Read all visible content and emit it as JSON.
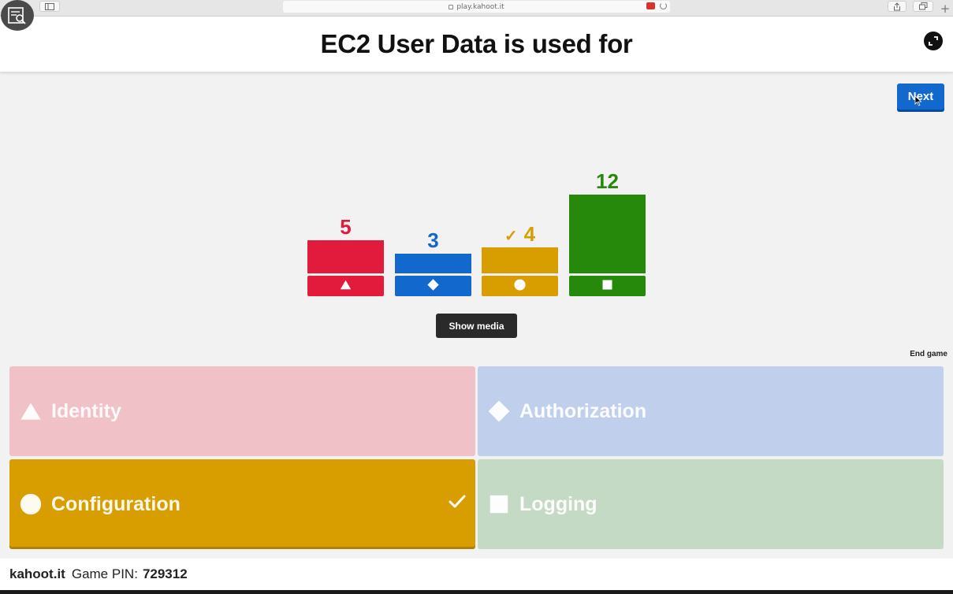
{
  "browser": {
    "url": "play.kahoot.it"
  },
  "question": {
    "title": "EC2 User Data is used for"
  },
  "controls": {
    "next_label": "Next",
    "show_media_label": "Show media",
    "end_game_label": "End game"
  },
  "chart_data": {
    "type": "bar",
    "categories": [
      "Identity",
      "Authorization",
      "Configuration",
      "Logging"
    ],
    "values": [
      5,
      3,
      4,
      12
    ],
    "correct": [
      false,
      false,
      true,
      false
    ],
    "shapes": [
      "triangle",
      "diamond",
      "circle",
      "square"
    ],
    "colors": [
      "#e21b3c",
      "#1368ce",
      "#d89e00",
      "#26890c"
    ]
  },
  "answers": [
    {
      "label": "Identity",
      "shape": "triangle",
      "color": "#f1c1c8",
      "correct": false
    },
    {
      "label": "Authorization",
      "shape": "diamond",
      "color": "#c0d0ec",
      "correct": false
    },
    {
      "label": "Configuration",
      "shape": "circle",
      "color": "#d89e00",
      "correct": true
    },
    {
      "label": "Logging",
      "shape": "square",
      "color": "#c5dac4",
      "correct": false
    }
  ],
  "footer": {
    "brand": "kahoot.it",
    "pin_label": "Game PIN:",
    "pin": "729312"
  }
}
